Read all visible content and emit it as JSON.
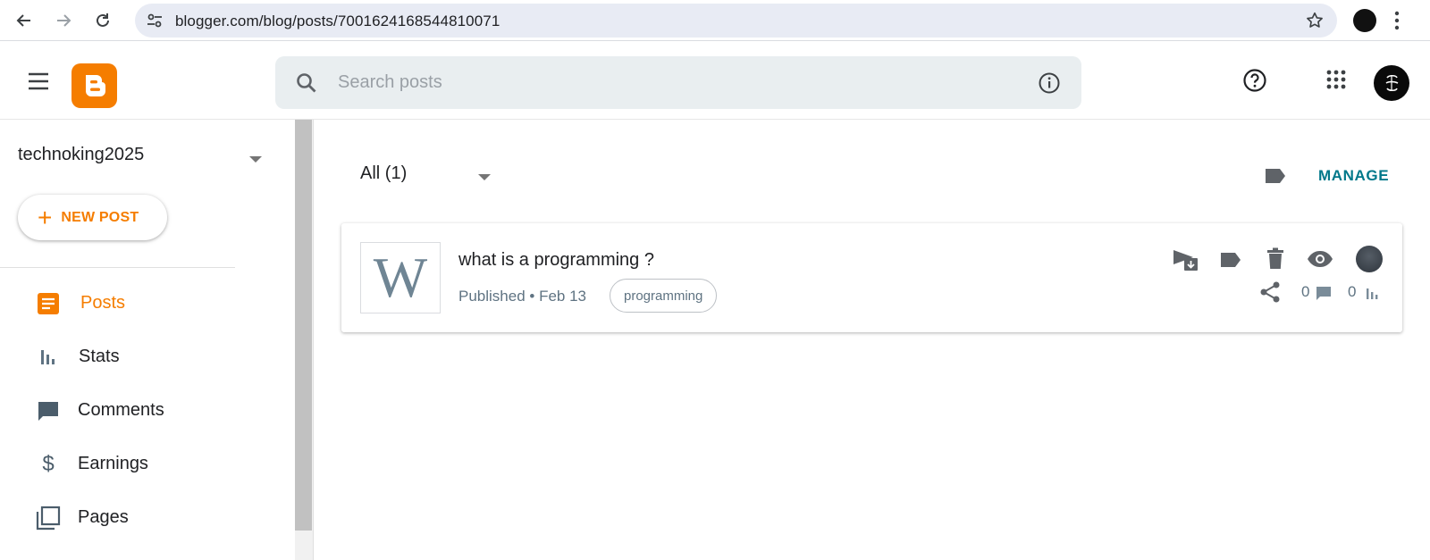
{
  "browser": {
    "url": "blogger.com/blog/posts/7001624168544810071",
    "icons": [
      "back-icon",
      "forward-icon",
      "reload-icon",
      "site-settings-icon",
      "bookmark-star-icon",
      "kebab-menu-icon"
    ]
  },
  "header": {
    "search_placeholder": "Search posts",
    "brand_color": "#f57d00"
  },
  "sidebar": {
    "blog_name": "technoking2025",
    "new_post_label": "NEW POST",
    "items": [
      {
        "label": "Posts",
        "icon": "posts-icon",
        "active": true
      },
      {
        "label": "Stats",
        "icon": "stats-icon",
        "active": false
      },
      {
        "label": "Comments",
        "icon": "comments-icon",
        "active": false
      },
      {
        "label": "Earnings",
        "icon": "dollar-icon",
        "active": false
      },
      {
        "label": "Pages",
        "icon": "pages-icon",
        "active": false
      }
    ]
  },
  "main": {
    "filter_label": "All (1)",
    "manage_label": "MANAGE",
    "accent_color": "#00788a",
    "posts": [
      {
        "thumbnail_letter": "W",
        "title": "what is a programming ?",
        "status": "Published • Feb 13",
        "label_chip": "programming",
        "comment_count": "0",
        "view_count": "0"
      }
    ]
  }
}
